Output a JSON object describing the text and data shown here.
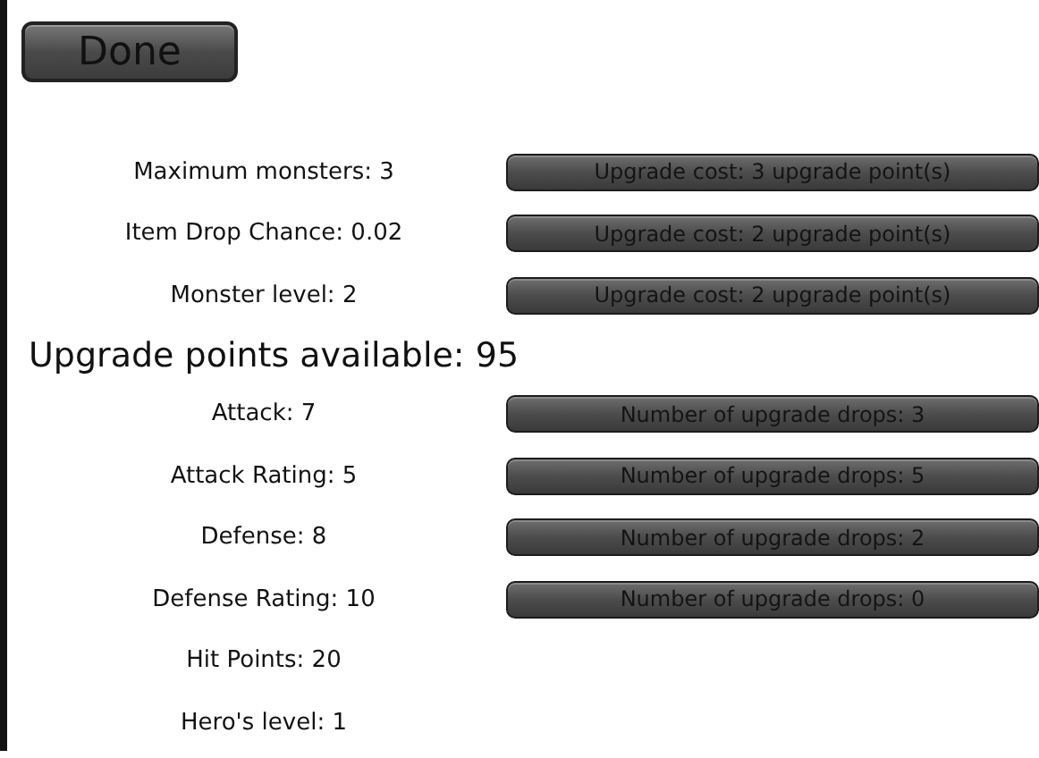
{
  "done_button": "Done",
  "settings": [
    {
      "label": "Maximum monsters: 3",
      "button": "Upgrade cost: 3 upgrade point(s)"
    },
    {
      "label": "Item Drop Chance: 0.02",
      "button": "Upgrade cost: 2 upgrade point(s)"
    },
    {
      "label": "Monster level: 2",
      "button": "Upgrade cost: 2 upgrade point(s)"
    }
  ],
  "points_available": "Upgrade points available: 95",
  "stats": [
    {
      "label": "Attack: 7",
      "button": "Number of upgrade drops: 3"
    },
    {
      "label": "Attack Rating: 5",
      "button": "Number of upgrade drops: 5"
    },
    {
      "label": "Defense: 8",
      "button": "Number of upgrade drops: 2"
    },
    {
      "label": "Defense Rating: 10",
      "button": "Number of upgrade drops: 0"
    },
    {
      "label": "Hit Points: 20"
    },
    {
      "label": "Hero's level: 1"
    }
  ]
}
